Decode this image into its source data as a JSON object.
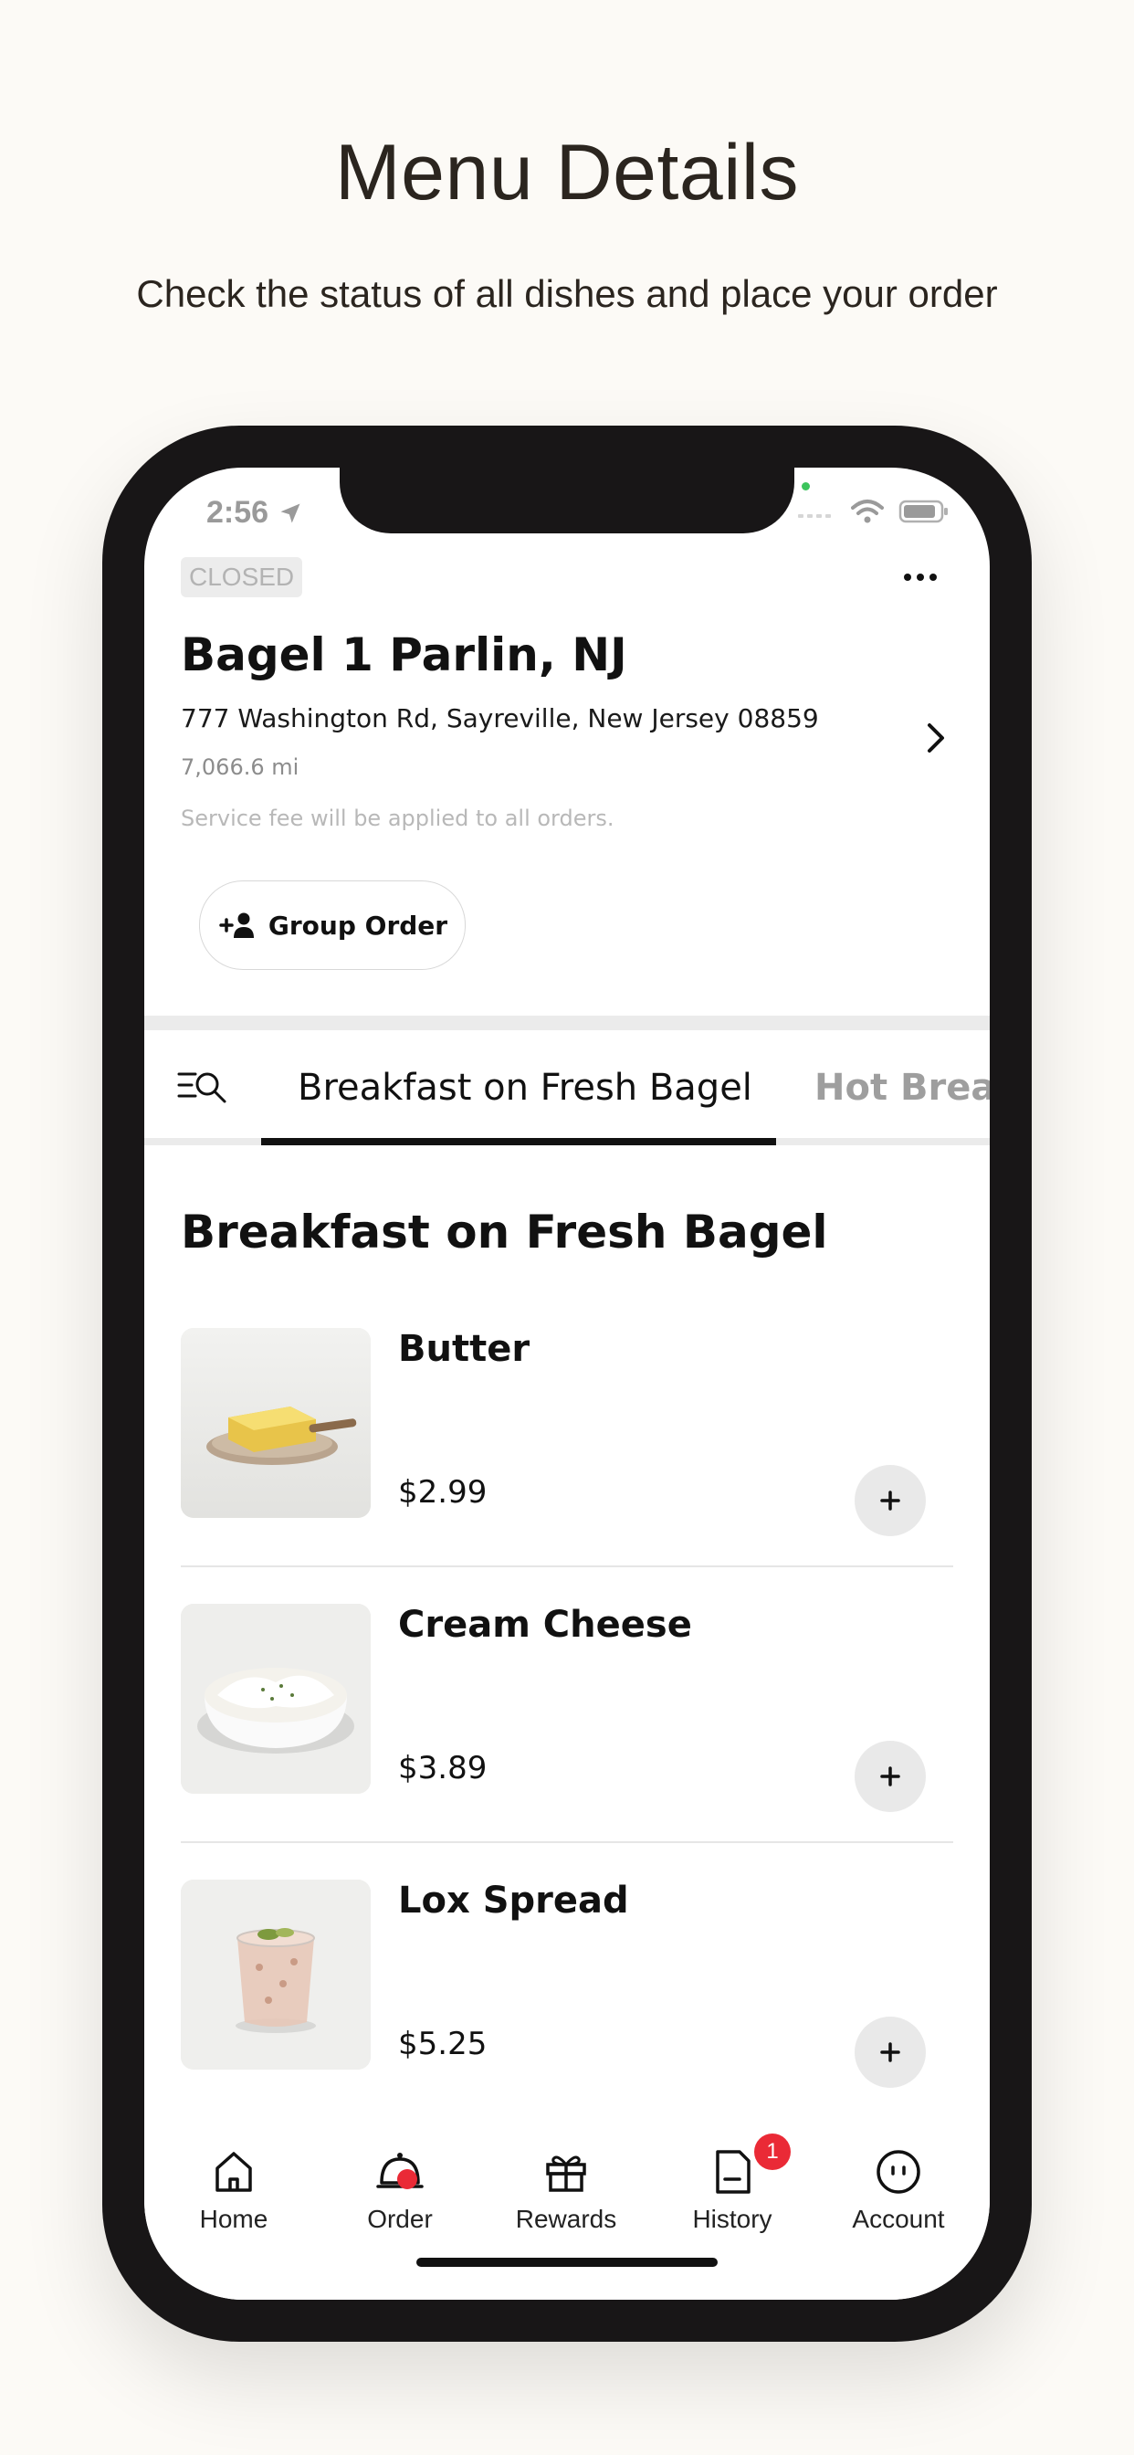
{
  "hero": {
    "title": "Menu Details",
    "subtitle": "Check the status of all dishes and place your order"
  },
  "status_bar": {
    "time": "2:56"
  },
  "store": {
    "status": "CLOSED",
    "name": "Bagel 1 Parlin, NJ",
    "address": "777 Washington Rd, Sayreville, New Jersey 08859",
    "distance": "7,066.6 mi",
    "service_note": "Service fee will be applied to all orders.",
    "group_order_label": "Group Order"
  },
  "tabs": [
    {
      "label": "Breakfast on Fresh Bagel",
      "active": true
    },
    {
      "label": "Hot Break",
      "active": false
    }
  ],
  "section": {
    "title": "Breakfast on Fresh Bagel"
  },
  "items": [
    {
      "name": "Butter",
      "price": "$2.99"
    },
    {
      "name": "Cream Cheese",
      "price": "$3.89"
    },
    {
      "name": "Lox Spread",
      "price": "$5.25"
    }
  ],
  "bottom_nav": {
    "items": [
      {
        "label": "Home",
        "icon": "home-icon"
      },
      {
        "label": "Order",
        "icon": "order-cloche-icon"
      },
      {
        "label": "Rewards",
        "icon": "gift-icon"
      },
      {
        "label": "History",
        "icon": "receipt-icon",
        "badge": "1"
      },
      {
        "label": "Account",
        "icon": "account-face-icon"
      }
    ]
  },
  "colors": {
    "background": "#fcfaf6",
    "accent_red": "#ea2a36",
    "text_dark": "#111111"
  }
}
